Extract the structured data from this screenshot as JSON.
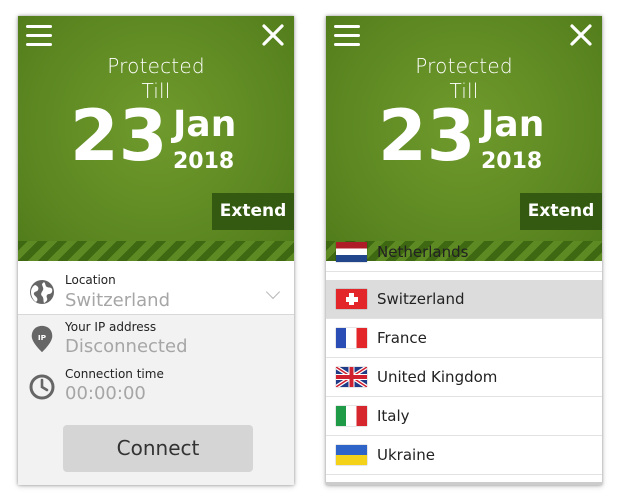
{
  "status": {
    "protected_line1": "Protected",
    "protected_line2": "Till",
    "day": "23",
    "month": "Jan",
    "year": "2018",
    "extend_label": "Extend"
  },
  "info": {
    "location_label": "Location",
    "location_value": "Switzerland",
    "ip_label": "Your IP address",
    "ip_value": "Disconnected",
    "time_label": "Connection time",
    "time_value": "00:00:00",
    "connect_label": "Connect"
  },
  "countries": {
    "partial": "Netherlands",
    "items": [
      "Switzerland",
      "France",
      "United Kingdom",
      "Italy",
      "Ukraine"
    ],
    "selected": "Switzerland"
  },
  "colors": {
    "hero_green": "#5f8a23",
    "extend_dark": "#335a10",
    "connect_gray": "#d5d5d5"
  }
}
